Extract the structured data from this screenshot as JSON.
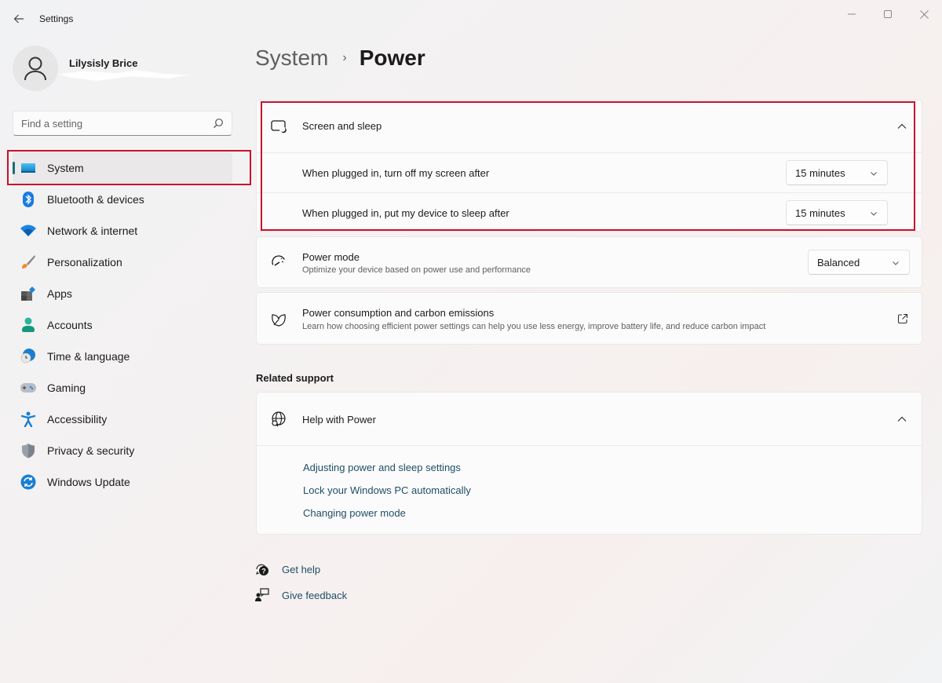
{
  "window": {
    "title": "Settings",
    "back_icon": "arrow-left-icon",
    "controls": [
      "minimize-icon",
      "maximize-icon",
      "close-icon"
    ]
  },
  "profile": {
    "name": "Lilysisly Brice",
    "avatar_icon": "person-icon"
  },
  "search": {
    "placeholder": "Find a setting",
    "value": "",
    "icon": "search-icon"
  },
  "sidebar": {
    "items": [
      {
        "label": "System",
        "icon": "monitor-icon",
        "active": true
      },
      {
        "label": "Bluetooth & devices",
        "icon": "bluetooth-icon"
      },
      {
        "label": "Network & internet",
        "icon": "wifi-icon"
      },
      {
        "label": "Personalization",
        "icon": "paintbrush-icon"
      },
      {
        "label": "Apps",
        "icon": "apps-icon"
      },
      {
        "label": "Accounts",
        "icon": "account-icon"
      },
      {
        "label": "Time & language",
        "icon": "clock-globe-icon"
      },
      {
        "label": "Gaming",
        "icon": "gamepad-icon"
      },
      {
        "label": "Accessibility",
        "icon": "accessibility-icon"
      },
      {
        "label": "Privacy & security",
        "icon": "shield-icon"
      },
      {
        "label": "Windows Update",
        "icon": "update-icon"
      }
    ]
  },
  "breadcrumb": {
    "parent": "System",
    "separator": "›",
    "current": "Power"
  },
  "screen_sleep": {
    "title": "Screen and sleep",
    "icon": "screen-sleep-icon",
    "expanded": true,
    "settings": [
      {
        "label": "When plugged in, turn off my screen after",
        "value": "15 minutes"
      },
      {
        "label": "When plugged in, put my device to sleep after",
        "value": "15 minutes"
      }
    ]
  },
  "power_mode": {
    "title": "Power mode",
    "subtitle": "Optimize your device based on power use and performance",
    "value": "Balanced",
    "icon": "gauge-icon"
  },
  "carbon": {
    "title": "Power consumption and carbon emissions",
    "subtitle": "Learn how choosing efficient power settings can help you use less energy, improve battery life, and reduce carbon impact",
    "icon": "leaf-icon",
    "action_icon": "external-link-icon"
  },
  "related_support": {
    "heading": "Related support",
    "help_title": "Help with Power",
    "help_icon": "globe-search-icon",
    "expanded": true,
    "links": [
      "Adjusting power and sleep settings",
      "Lock your Windows PC automatically",
      "Changing power mode"
    ]
  },
  "footer": {
    "get_help": "Get help",
    "give_feedback": "Give feedback"
  },
  "colors": {
    "highlight": "#c8102e",
    "accent": "#1c6c7a",
    "link": "#1f4e66"
  }
}
